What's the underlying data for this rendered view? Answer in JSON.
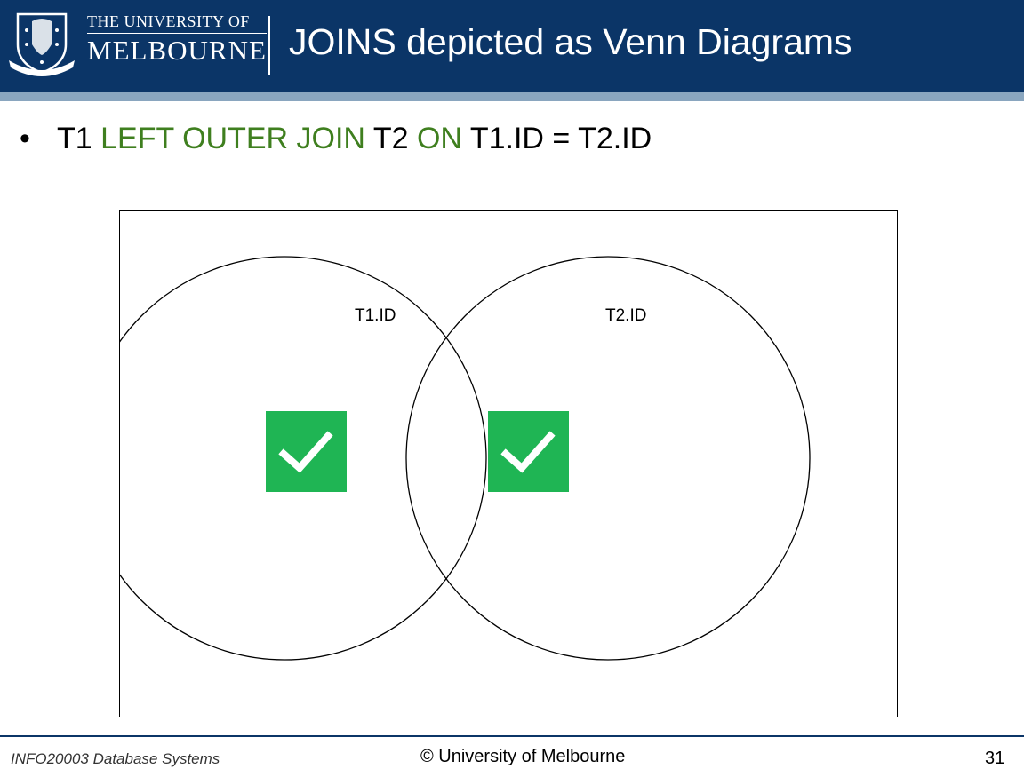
{
  "header": {
    "logo": {
      "line1": "THE UNIVERSITY OF",
      "line2": "MELBOURNE",
      "crest_icon": "university-crest-icon"
    },
    "title": "JOINS depicted as Venn Diagrams",
    "background_color": "#0b3567"
  },
  "bullet": {
    "parts": [
      "T1",
      "LEFT OUTER JOIN",
      "T2",
      "ON",
      "T1.ID = T2.ID"
    ],
    "keyword_color": "#3f7f1f"
  },
  "diagram": {
    "left_set_label": "T1.ID",
    "right_set_label": "T2.ID",
    "check_icon": "checkmark-icon",
    "check_color": "#1fb554",
    "checked_regions": [
      "left-only",
      "intersection"
    ]
  },
  "footer": {
    "course": "INFO20003 Database Systems",
    "copyright": "© University of Melbourne",
    "page_number": "31"
  }
}
